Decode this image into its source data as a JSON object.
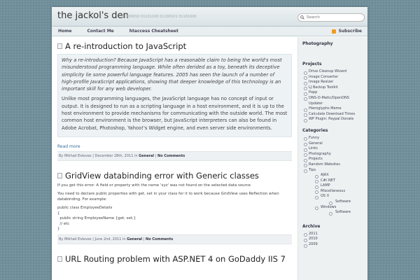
{
  "header": {
    "site_title": "the jackol's den",
    "tagline": "01100010 01101100 01100101 01101000",
    "search_placeholder": "Search"
  },
  "nav": {
    "items": [
      "Home",
      "Contact Me",
      "htaccess Cheatsheet"
    ],
    "subscribe": "Subscribe"
  },
  "posts": [
    {
      "title": "A re-introduction to JavaScript",
      "quote_italic": "Why a re-introduction? Because JavaScript has a reasonable claim to being the world's most misunderstood programming language. While often derided as a toy, beneath its deceptive simplicity lie some powerful language features. 2005 has seen the launch of a number of high-profile JavaScript applications, showing that deeper knowledge of this technology is an important skill for any web developer.",
      "quote_normal": "Unlike most programming languages, the JavaScript language has no concept of input or output. It is designed to run as a scripting language in a host environment, and it is up to the host environment to provide mechanisms for communicating with the outside world. The most common host environment is the browser, but JavaScript interpreters can also be found in Adobe Acrobat, Photoshop, Yahoo!'s Widget engine, and even server side environments.",
      "read_more": "Read more",
      "meta_by": "By Mikhail Esteves | December 28th, 2011 in",
      "meta_cat": "General",
      "meta_comments": "No Comments"
    },
    {
      "title": "GridView databinding error with Generic classes",
      "p1": "If you get this error: A field or property with the name 'xyz' was not found on the selected data source",
      "p2": "You need to declare public properties with get, set in your class for it to work because GridView uses Reflection when databinding. For example:",
      "code": "public class EmployeeDetails\n{\n  public string EmployeeName {get; set;}\n  // etc\n}",
      "meta_by": "By Mikhail Esteves | June 2nd, 2011 in",
      "meta_cat": "General",
      "meta_comments": "No Comments"
    },
    {
      "title": "URL Routing problem with ASP.NET 4 on GoDaddy IIS 7"
    }
  ],
  "sidebar": {
    "photography_title": "Photography",
    "projects_title": "Projects",
    "projects": [
      "Drive Cleanup Wizard",
      "Image Converter",
      "Image Resizer",
      "LJ Backup Toolkit",
      "Popp",
      "DNS-O-Matic/OpenDNS Updater",
      "Hieroglyphs Meme",
      "Calculate Download Times",
      "WP Plugin: Paypal Donate"
    ],
    "categories_title": "Categories",
    "categories": [
      "Funny",
      "General",
      "Links",
      "Photography",
      "Projects",
      "Random Websites",
      "Tips"
    ],
    "tips_sub": [
      "AJAX",
      "C#/.NET",
      "LAMP",
      "Miscellaneous",
      "OS X"
    ],
    "osx_sub": "Software",
    "windows": "Windows",
    "windows_sub": "Software",
    "archive_title": "Archive",
    "archive": [
      "2011",
      "2010",
      "2009"
    ]
  }
}
